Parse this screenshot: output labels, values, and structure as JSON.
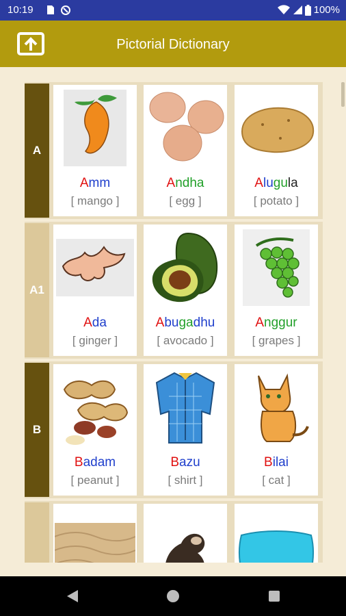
{
  "status": {
    "time": "10:19",
    "battery": "100%"
  },
  "app_bar": {
    "title": "Pictorial Dictionary"
  },
  "rows": [
    {
      "letter": "A",
      "cards": [
        {
          "parts": [
            {
              "t": "A",
              "c": "r"
            },
            {
              "t": "mm",
              "c": "b"
            }
          ],
          "meaning": "[ mango ]",
          "picture": "mango"
        },
        {
          "parts": [
            {
              "t": "A",
              "c": "r"
            },
            {
              "t": "ndha",
              "c": "g"
            }
          ],
          "meaning": "[ egg ]",
          "picture": "egg"
        },
        {
          "parts": [
            {
              "t": "A",
              "c": "r"
            },
            {
              "t": "lu",
              "c": "b"
            },
            {
              "t": "gu",
              "c": "g"
            },
            {
              "t": "la",
              "c": "k"
            }
          ],
          "meaning": "[ potato ]",
          "picture": "potato"
        }
      ]
    },
    {
      "letter": "A1",
      "cards": [
        {
          "parts": [
            {
              "t": "A",
              "c": "r"
            },
            {
              "t": "da",
              "c": "b"
            }
          ],
          "meaning": "[ ginger ]",
          "picture": "ginger"
        },
        {
          "parts": [
            {
              "t": "A",
              "c": "r"
            },
            {
              "t": "bu",
              "c": "b"
            },
            {
              "t": "ga",
              "c": "g"
            },
            {
              "t": "dhu",
              "c": "b"
            }
          ],
          "meaning": "[ avocado ]",
          "picture": "avocado"
        },
        {
          "parts": [
            {
              "t": "A",
              "c": "r"
            },
            {
              "t": "nggur",
              "c": "g"
            }
          ],
          "meaning": "[ grapes ]",
          "picture": "grapes"
        }
      ]
    },
    {
      "letter": "B",
      "cards": [
        {
          "parts": [
            {
              "t": "B",
              "c": "r"
            },
            {
              "t": "adam",
              "c": "b"
            }
          ],
          "meaning": "[ peanut ]",
          "picture": "peanut"
        },
        {
          "parts": [
            {
              "t": "B",
              "c": "r"
            },
            {
              "t": "azu",
              "c": "b"
            }
          ],
          "meaning": "[ shirt ]",
          "picture": "shirt"
        },
        {
          "parts": [
            {
              "t": "B",
              "c": "r"
            },
            {
              "t": "ilai",
              "c": "b"
            }
          ],
          "meaning": "[ cat ]",
          "picture": "cat"
        }
      ]
    },
    {
      "letter": "",
      "cards": [
        {
          "parts": [],
          "meaning": "",
          "picture": "sand"
        },
        {
          "parts": [],
          "meaning": "",
          "picture": "monkey"
        },
        {
          "parts": [],
          "meaning": "",
          "picture": "pillow"
        }
      ]
    }
  ],
  "colors": {
    "status_bar": "#2B3BA0",
    "app_bar": "#B29B0E",
    "background": "#F5ECD7",
    "letter_dark": "#66510F",
    "letter_light": "#DCC89A"
  }
}
